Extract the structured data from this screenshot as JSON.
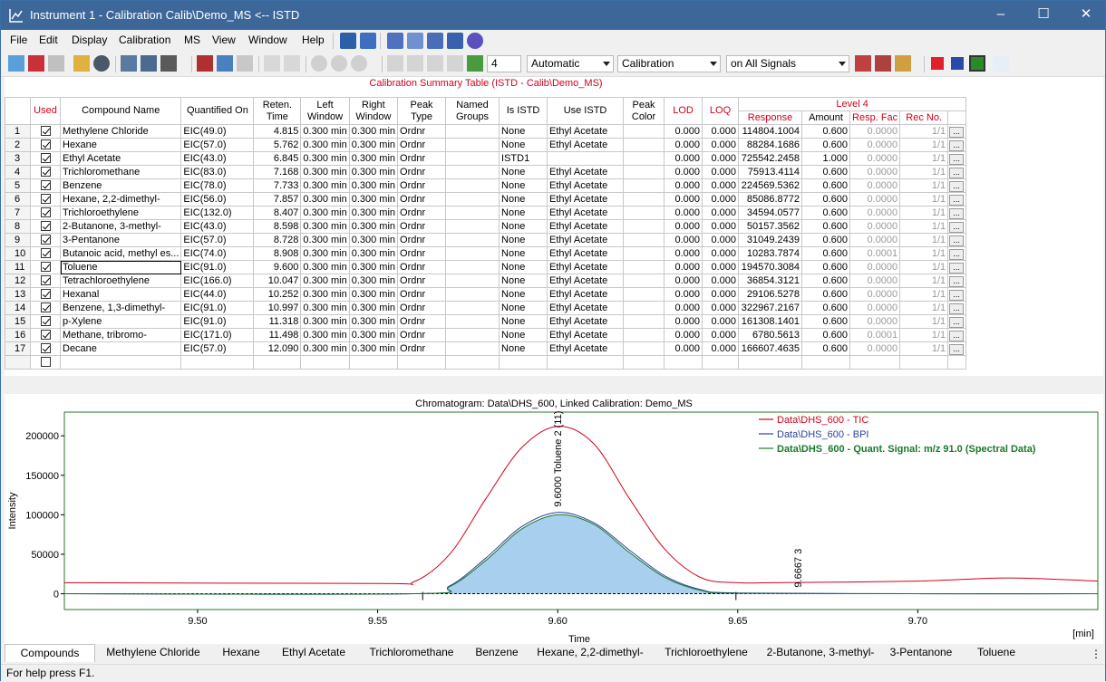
{
  "window": {
    "title": "Instrument 1 - Calibration Calib\\Demo_MS <-- ISTD"
  },
  "menu": [
    "File",
    "Edit",
    "Display",
    "Calibration",
    "MS",
    "View",
    "Window",
    "Help"
  ],
  "toolbar": {
    "spin_value": "4",
    "combo_mode": "Automatic",
    "combo_view": "Calibration",
    "combo_signals": "on All Signals"
  },
  "table": {
    "title": "Calibration Summary Table (ISTD - Calib\\Demo_MS)",
    "headers": {
      "used": "Used",
      "compound": "Compound Name",
      "quant": "Quantified On",
      "reten": "Reten.\nTime",
      "left": "Left\nWindow",
      "right": "Right\nWindow",
      "peak_type": "Peak\nType",
      "named": "Named\nGroups",
      "is_istd": "Is ISTD",
      "use_istd": "Use ISTD",
      "peak_color": "Peak\nColor",
      "lod": "LOD",
      "loq": "LOQ",
      "level": "Level 4",
      "response": "Response",
      "amount": "Amount",
      "resp_fac": "Resp. Fac",
      "rec_no": "Rec No."
    },
    "rows": [
      {
        "n": "1",
        "name": "Methylene Chloride",
        "q": "EIC(49.0)",
        "rt": "4.815",
        "lw": "0.300 min",
        "rw": "0.300 min",
        "pt": "Ordnr",
        "ng": "",
        "is": "None",
        "use": "Ethyl Acetate",
        "lod": "0.000",
        "loq": "0.000",
        "resp": "114804.1004",
        "amt": "0.600",
        "rf": "0.0000",
        "rec": "1/1"
      },
      {
        "n": "2",
        "name": "Hexane",
        "q": "EIC(57.0)",
        "rt": "5.762",
        "lw": "0.300 min",
        "rw": "0.300 min",
        "pt": "Ordnr",
        "ng": "",
        "is": "None",
        "use": "Ethyl Acetate",
        "lod": "0.000",
        "loq": "0.000",
        "resp": "88284.1686",
        "amt": "0.600",
        "rf": "0.0000",
        "rec": "1/1"
      },
      {
        "n": "3",
        "name": "Ethyl Acetate",
        "q": "EIC(43.0)",
        "rt": "6.845",
        "lw": "0.300 min",
        "rw": "0.300 min",
        "pt": "Ordnr",
        "ng": "",
        "is": "ISTD1",
        "use": "",
        "lod": "0.000",
        "loq": "0.000",
        "resp": "725542.2458",
        "amt": "1.000",
        "rf": "0.0000",
        "rec": "1/1"
      },
      {
        "n": "4",
        "name": "Trichloromethane",
        "q": "EIC(83.0)",
        "rt": "7.168",
        "lw": "0.300 min",
        "rw": "0.300 min",
        "pt": "Ordnr",
        "ng": "",
        "is": "None",
        "use": "Ethyl Acetate",
        "lod": "0.000",
        "loq": "0.000",
        "resp": "75913.4114",
        "amt": "0.600",
        "rf": "0.0000",
        "rec": "1/1"
      },
      {
        "n": "5",
        "name": "Benzene",
        "q": "EIC(78.0)",
        "rt": "7.733",
        "lw": "0.300 min",
        "rw": "0.300 min",
        "pt": "Ordnr",
        "ng": "",
        "is": "None",
        "use": "Ethyl Acetate",
        "lod": "0.000",
        "loq": "0.000",
        "resp": "224569.5362",
        "amt": "0.600",
        "rf": "0.0000",
        "rec": "1/1"
      },
      {
        "n": "6",
        "name": "Hexane, 2,2-dimethyl-",
        "q": "EIC(56.0)",
        "rt": "7.857",
        "lw": "0.300 min",
        "rw": "0.300 min",
        "pt": "Ordnr",
        "ng": "",
        "is": "None",
        "use": "Ethyl Acetate",
        "lod": "0.000",
        "loq": "0.000",
        "resp": "85086.8772",
        "amt": "0.600",
        "rf": "0.0000",
        "rec": "1/1"
      },
      {
        "n": "7",
        "name": "Trichloroethylene",
        "q": "EIC(132.0)",
        "rt": "8.407",
        "lw": "0.300 min",
        "rw": "0.300 min",
        "pt": "Ordnr",
        "ng": "",
        "is": "None",
        "use": "Ethyl Acetate",
        "lod": "0.000",
        "loq": "0.000",
        "resp": "34594.0577",
        "amt": "0.600",
        "rf": "0.0000",
        "rec": "1/1"
      },
      {
        "n": "8",
        "name": "2-Butanone, 3-methyl-",
        "q": "EIC(43.0)",
        "rt": "8.598",
        "lw": "0.300 min",
        "rw": "0.300 min",
        "pt": "Ordnr",
        "ng": "",
        "is": "None",
        "use": "Ethyl Acetate",
        "lod": "0.000",
        "loq": "0.000",
        "resp": "50157.3562",
        "amt": "0.600",
        "rf": "0.0000",
        "rec": "1/1"
      },
      {
        "n": "9",
        "name": "3-Pentanone",
        "q": "EIC(57.0)",
        "rt": "8.728",
        "lw": "0.300 min",
        "rw": "0.300 min",
        "pt": "Ordnr",
        "ng": "",
        "is": "None",
        "use": "Ethyl Acetate",
        "lod": "0.000",
        "loq": "0.000",
        "resp": "31049.2439",
        "amt": "0.600",
        "rf": "0.0000",
        "rec": "1/1"
      },
      {
        "n": "10",
        "name": "Butanoic acid, methyl es...",
        "q": "EIC(74.0)",
        "rt": "8.908",
        "lw": "0.300 min",
        "rw": "0.300 min",
        "pt": "Ordnr",
        "ng": "",
        "is": "None",
        "use": "Ethyl Acetate",
        "lod": "0.000",
        "loq": "0.000",
        "resp": "10283.7874",
        "amt": "0.600",
        "rf": "0.0001",
        "rec": "1/1"
      },
      {
        "n": "11",
        "name": "Toluene",
        "q": "EIC(91.0)",
        "rt": "9.600",
        "lw": "0.300 min",
        "rw": "0.300 min",
        "pt": "Ordnr",
        "ng": "",
        "is": "None",
        "use": "Ethyl Acetate",
        "lod": "0.000",
        "loq": "0.000",
        "resp": "194570.3084",
        "amt": "0.600",
        "rf": "0.0000",
        "rec": "1/1"
      },
      {
        "n": "12",
        "name": "Tetrachloroethylene",
        "q": "EIC(166.0)",
        "rt": "10.047",
        "lw": "0.300 min",
        "rw": "0.300 min",
        "pt": "Ordnr",
        "ng": "",
        "is": "None",
        "use": "Ethyl Acetate",
        "lod": "0.000",
        "loq": "0.000",
        "resp": "36854.3121",
        "amt": "0.600",
        "rf": "0.0000",
        "rec": "1/1"
      },
      {
        "n": "13",
        "name": "Hexanal",
        "q": "EIC(44.0)",
        "rt": "10.252",
        "lw": "0.300 min",
        "rw": "0.300 min",
        "pt": "Ordnr",
        "ng": "",
        "is": "None",
        "use": "Ethyl Acetate",
        "lod": "0.000",
        "loq": "0.000",
        "resp": "29106.5278",
        "amt": "0.600",
        "rf": "0.0000",
        "rec": "1/1"
      },
      {
        "n": "14",
        "name": "Benzene, 1,3-dimethyl-",
        "q": "EIC(91.0)",
        "rt": "10.997",
        "lw": "0.300 min",
        "rw": "0.300 min",
        "pt": "Ordnr",
        "ng": "",
        "is": "None",
        "use": "Ethyl Acetate",
        "lod": "0.000",
        "loq": "0.000",
        "resp": "322967.2167",
        "amt": "0.600",
        "rf": "0.0000",
        "rec": "1/1"
      },
      {
        "n": "15",
        "name": "p-Xylene",
        "q": "EIC(91.0)",
        "rt": "11.318",
        "lw": "0.300 min",
        "rw": "0.300 min",
        "pt": "Ordnr",
        "ng": "",
        "is": "None",
        "use": "Ethyl Acetate",
        "lod": "0.000",
        "loq": "0.000",
        "resp": "161308.1401",
        "amt": "0.600",
        "rf": "0.0000",
        "rec": "1/1"
      },
      {
        "n": "16",
        "name": "Methane, tribromo-",
        "q": "EIC(171.0)",
        "rt": "11.498",
        "lw": "0.300 min",
        "rw": "0.300 min",
        "pt": "Ordnr",
        "ng": "",
        "is": "None",
        "use": "Ethyl Acetate",
        "lod": "0.000",
        "loq": "0.000",
        "resp": "6780.5613",
        "amt": "0.600",
        "rf": "0.0001",
        "rec": "1/1"
      },
      {
        "n": "17",
        "name": "Decane",
        "q": "EIC(57.0)",
        "rt": "12.090",
        "lw": "0.300 min",
        "rw": "0.300 min",
        "pt": "Ordnr",
        "ng": "",
        "is": "None",
        "use": "Ethyl Acetate",
        "lod": "0.000",
        "loq": "0.000",
        "resp": "166607.4635",
        "amt": "0.600",
        "rf": "0.0000",
        "rec": "1/1"
      }
    ]
  },
  "chart_data": {
    "type": "line",
    "title": "Chromatogram: Data\\DHS_600, Linked Calibration: Demo_MS",
    "xlabel": "Time",
    "ylabel": "Intensity",
    "x_unit": "[min]",
    "xlim": [
      9.463,
      9.75
    ],
    "ylim": [
      -20000,
      230000
    ],
    "x_ticks": [
      "9.50",
      "9.55",
      "9.60",
      "9.65",
      "9.70"
    ],
    "y_ticks": [
      "0",
      "50000",
      "100000",
      "150000",
      "200000"
    ],
    "legend": "top-right",
    "series": [
      {
        "name": "Data\\DHS_600 - TIC",
        "color": "#d0021b",
        "x": [
          9.463,
          9.55,
          9.56,
          9.57,
          9.58,
          9.59,
          9.6,
          9.61,
          9.62,
          9.63,
          9.64,
          9.65,
          9.66,
          9.7,
          9.725,
          9.75
        ],
        "y": [
          14000,
          13000,
          15000,
          50000,
          120000,
          185000,
          212000,
          190000,
          120000,
          55000,
          20000,
          14000,
          14000,
          16000,
          20000,
          16000
        ]
      },
      {
        "name": "Data\\DHS_600 - BPI",
        "color": "#2b3f9e",
        "x": [
          9.463,
          9.56,
          9.57,
          9.58,
          9.59,
          9.6,
          9.61,
          9.62,
          9.63,
          9.64,
          9.65,
          9.7,
          9.75
        ],
        "y": [
          0,
          0,
          10000,
          45000,
          85000,
          103000,
          90000,
          55000,
          22000,
          5000,
          1000,
          0,
          0
        ]
      },
      {
        "name": "Data\\DHS_600 - Quant. Signal: m/z 91.0 (Spectral Data)",
        "color": "#1a7a2a",
        "x": [
          9.463,
          9.56,
          9.57,
          9.58,
          9.59,
          9.6,
          9.61,
          9.62,
          9.63,
          9.64,
          9.65,
          9.7,
          9.75
        ],
        "y": [
          0,
          0,
          9000,
          42000,
          82000,
          100000,
          88000,
          52000,
          20000,
          4000,
          500,
          0,
          0
        ]
      }
    ],
    "annotations": [
      "9.6000  Toluene  2 (11)",
      "9.6667  3"
    ]
  },
  "tabs": [
    "Compounds",
    "Methylene Chloride",
    "Hexane",
    "Ethyl Acetate",
    "Trichloromethane",
    "Benzene",
    "Hexane, 2,2-dimethyl-",
    "Trichloroethylene",
    "2-Butanone, 3-methyl-",
    "3-Pentanone",
    "Toluene"
  ],
  "status": "For help press F1."
}
